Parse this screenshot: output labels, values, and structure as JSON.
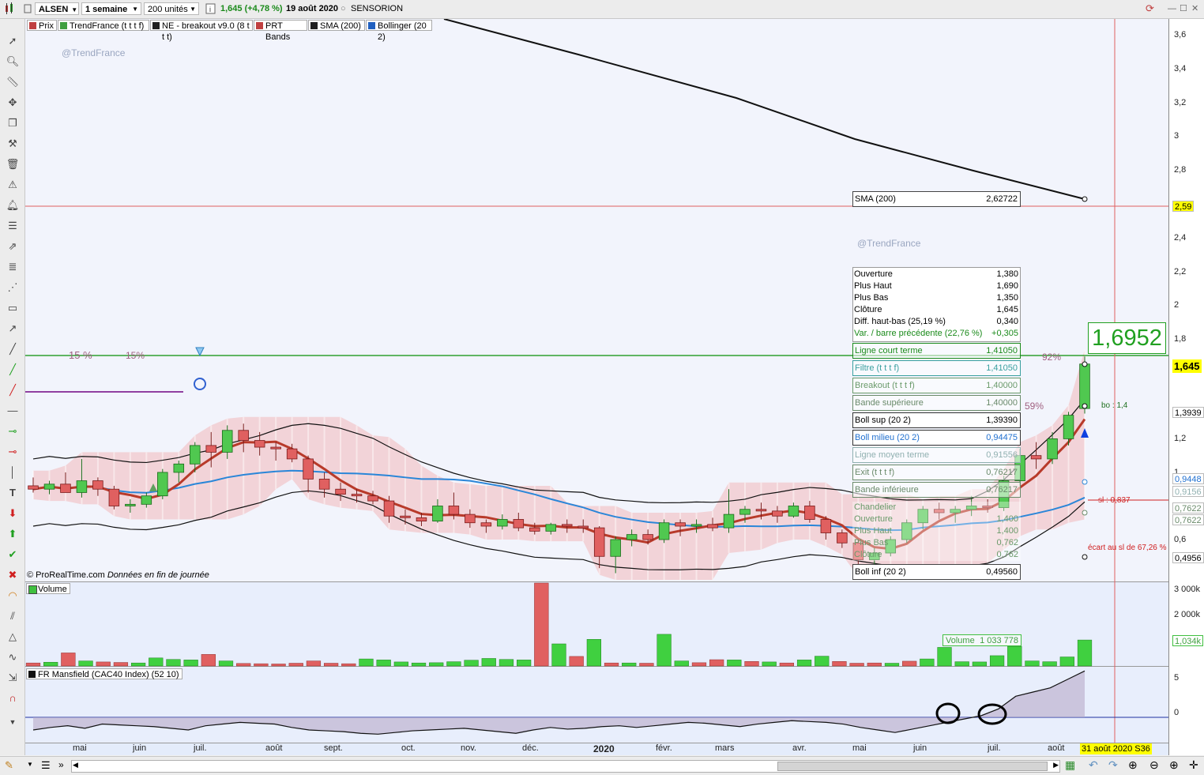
{
  "toolbar": {
    "symbol": "ALSEN",
    "timeframe": "1 semaine",
    "units": "200 unités",
    "quote": "1,645 (+4,78 %)",
    "date": "19 août 2020",
    "name": "SENSORION"
  },
  "indicators": [
    {
      "label": "Prix",
      "color": "#c04040"
    },
    {
      "label": "TrendFrance (t t t f)",
      "color": "#40a040"
    },
    {
      "label": "NE - breakout v9.0 (8 t t t)",
      "color": "#202020"
    },
    {
      "label": "PRT Bands",
      "color": "#c04040"
    },
    {
      "label": "SMA (200)",
      "color": "#202020"
    },
    {
      "label": "Bollinger (20 2)",
      "color": "#2060c0"
    }
  ],
  "watermarks": [
    "@TrendFrance",
    "@TrendFrance"
  ],
  "credit": {
    "source": "© ProRealTime.com",
    "note": "Données en fin de journée"
  },
  "sma_box": {
    "label": "SMA (200)",
    "value": "2,62722"
  },
  "info_rows": [
    {
      "label": "Ouverture",
      "value": "1,380"
    },
    {
      "label": "Plus Haut",
      "value": "1,690"
    },
    {
      "label": "Plus Bas",
      "value": "1,350"
    },
    {
      "label": "Clôture",
      "value": "1,645"
    },
    {
      "label": "Diff. haut-bas (25,19 %)",
      "value": "0,340"
    },
    {
      "label": "Var. / barre précédente (22,76 %)",
      "value": "+0,305"
    }
  ],
  "indicator_rows": [
    {
      "label": "Ligne court terme",
      "value": "1,41050",
      "color": "#1a8a1a"
    },
    {
      "label": "Filtre (t t t f)",
      "value": "1,41050",
      "color": "#3aa0a0"
    },
    {
      "label": "Breakout (t t t f)",
      "value": "1,40000",
      "color": "#6a9a6a"
    },
    {
      "label": "Bande supérieure",
      "value": "1,40000",
      "color": "#6a8a6a"
    },
    {
      "label": "Boll sup (20 2)",
      "value": "1,39390",
      "color": "#000000",
      "boxed": true
    },
    {
      "label": "Boll milieu (20 2)",
      "value": "0,94475",
      "color": "#2070d0",
      "boxed": true
    },
    {
      "label": "Ligne moyen terme",
      "value": "0,91556",
      "color": "#90b0b0"
    },
    {
      "label": "Exit (t t t f)",
      "value": "0,76217",
      "color": "#6a8a6a"
    },
    {
      "label": "Bande inférieure",
      "value": "0,76217",
      "color": "#6a8a6a"
    }
  ],
  "candle_rows": [
    {
      "label": "Chandelier",
      "value": ""
    },
    {
      "label": "Ouverture",
      "value": "1,400"
    },
    {
      "label": "Plus Haut",
      "value": "1,400"
    },
    {
      "label": "Plus Bas",
      "value": "0,762"
    },
    {
      "label": "Clôture",
      "value": "0,762"
    }
  ],
  "boll_inf": {
    "label": "Boll inf (20 2)",
    "value": "0,49560"
  },
  "annotations": {
    "pct_15a": "15 %",
    "pct_15b": "15%",
    "pct_92": "92%",
    "pct_59": "59%",
    "bo": "bo : 1,4",
    "sl": "sl : 0,837",
    "ecart": "écart au sl de 67,26 %",
    "big_price": "1,6952",
    "volume_label": "Volume",
    "volume_value": "1 033 778"
  },
  "right_axis": {
    "price_ticks": [
      "3,6",
      "3,4",
      "3,2",
      "3",
      "2,8",
      "2,6272",
      "2,4",
      "2,2",
      "2",
      "1,8",
      "1,4105",
      "1,2",
      "1",
      "0,6"
    ],
    "price_tags": [
      {
        "text": "2,59",
        "bg": "#ffff00",
        "fg": "#000"
      },
      {
        "text": "1,645",
        "bg": "#ffff00",
        "fg": "#000"
      },
      {
        "text": "1,3939",
        "bg": "#ffffff",
        "fg": "#000"
      },
      {
        "text": "0,9448",
        "bg": "#ffffff",
        "fg": "#2070d0"
      },
      {
        "text": "0,9156",
        "bg": "#ffffff",
        "fg": "#90b0b0"
      },
      {
        "text": "0,7622",
        "bg": "#ffffff",
        "fg": "#6a8a6a"
      },
      {
        "text": "0,7622",
        "bg": "#ffffff",
        "fg": "#6a8a6a"
      },
      {
        "text": "0,4956",
        "bg": "#ffffff",
        "fg": "#000"
      }
    ],
    "volume_ticks": [
      "3 000k",
      "2 000k",
      "1 000k"
    ],
    "volume_tag": "1,034k",
    "mansfield_ticks": [
      "5",
      "0"
    ]
  },
  "volume_panel_title": "Volume",
  "mansfield_panel_title": "FR Mansfield (CAC40 Index) (52 10)",
  "x_axis": [
    "mai",
    "juin",
    "juil.",
    "août",
    "sept.",
    "oct.",
    "nov.",
    "déc.",
    "2020",
    "févr.",
    "mars",
    "avr.",
    "mai",
    "juin",
    "juil.",
    "août"
  ],
  "x_tag": "31 août 2020 S36",
  "chart_data": {
    "type": "candlestick",
    "title": "SENSORION",
    "interval": "1 semaine",
    "ylim": [
      0.4,
      3.7
    ],
    "candles": [
      [
        0.92,
        0.97,
        0.88,
        0.9
      ],
      [
        0.9,
        0.95,
        0.87,
        0.93
      ],
      [
        0.93,
        1.0,
        0.89,
        0.88
      ],
      [
        0.88,
        1.08,
        0.85,
        0.95
      ],
      [
        0.95,
        0.97,
        0.86,
        0.9
      ],
      [
        0.9,
        0.92,
        0.78,
        0.8
      ],
      [
        0.8,
        0.84,
        0.76,
        0.81
      ],
      [
        0.81,
        0.88,
        0.79,
        0.86
      ],
      [
        0.86,
        1.02,
        0.84,
        1.0
      ],
      [
        1.0,
        1.07,
        0.94,
        1.05
      ],
      [
        1.05,
        1.18,
        1.0,
        1.16
      ],
      [
        1.16,
        1.24,
        1.03,
        1.12
      ],
      [
        1.12,
        1.28,
        1.08,
        1.25
      ],
      [
        1.25,
        1.29,
        1.12,
        1.19
      ],
      [
        1.19,
        1.24,
        1.1,
        1.15
      ],
      [
        1.15,
        1.18,
        1.07,
        1.14
      ],
      [
        1.14,
        1.17,
        1.06,
        1.08
      ],
      [
        1.08,
        1.1,
        0.88,
        0.96
      ],
      [
        0.96,
        1.0,
        0.85,
        0.9
      ],
      [
        0.9,
        0.94,
        0.83,
        0.87
      ],
      [
        0.87,
        0.9,
        0.82,
        0.86
      ],
      [
        0.86,
        0.89,
        0.81,
        0.83
      ],
      [
        0.83,
        0.86,
        0.7,
        0.74
      ],
      [
        0.74,
        0.78,
        0.69,
        0.73
      ],
      [
        0.73,
        0.76,
        0.68,
        0.71
      ],
      [
        0.71,
        0.84,
        0.7,
        0.8
      ],
      [
        0.8,
        0.88,
        0.72,
        0.75
      ],
      [
        0.75,
        0.78,
        0.67,
        0.7
      ],
      [
        0.7,
        0.72,
        0.64,
        0.68
      ],
      [
        0.68,
        0.75,
        0.66,
        0.72
      ],
      [
        0.72,
        0.76,
        0.65,
        0.67
      ],
      [
        0.67,
        0.7,
        0.63,
        0.65
      ],
      [
        0.65,
        0.7,
        0.63,
        0.69
      ],
      [
        0.69,
        0.72,
        0.64,
        0.68
      ],
      [
        0.68,
        0.72,
        0.64,
        0.67
      ],
      [
        0.67,
        0.68,
        0.43,
        0.5
      ],
      [
        0.5,
        0.62,
        0.4,
        0.6
      ],
      [
        0.6,
        0.66,
        0.56,
        0.63
      ],
      [
        0.63,
        0.66,
        0.57,
        0.6
      ],
      [
        0.6,
        0.72,
        0.58,
        0.7
      ],
      [
        0.7,
        0.72,
        0.62,
        0.68
      ],
      [
        0.68,
        0.72,
        0.64,
        0.69
      ],
      [
        0.69,
        0.73,
        0.65,
        0.67
      ],
      [
        0.67,
        0.9,
        0.64,
        0.75
      ],
      [
        0.75,
        0.8,
        0.7,
        0.78
      ],
      [
        0.78,
        0.82,
        0.72,
        0.77
      ],
      [
        0.77,
        0.8,
        0.7,
        0.74
      ],
      [
        0.74,
        0.82,
        0.73,
        0.8
      ],
      [
        0.8,
        0.83,
        0.7,
        0.72
      ],
      [
        0.72,
        0.74,
        0.6,
        0.64
      ],
      [
        0.64,
        0.66,
        0.55,
        0.58
      ],
      [
        0.58,
        0.6,
        0.42,
        0.48
      ],
      [
        0.48,
        0.55,
        0.44,
        0.52
      ],
      [
        0.52,
        0.62,
        0.5,
        0.6
      ],
      [
        0.6,
        0.72,
        0.58,
        0.7
      ],
      [
        0.7,
        0.8,
        0.66,
        0.78
      ],
      [
        0.78,
        0.82,
        0.72,
        0.76
      ],
      [
        0.76,
        0.8,
        0.7,
        0.78
      ],
      [
        0.78,
        0.86,
        0.74,
        0.8
      ],
      [
        0.8,
        0.84,
        0.76,
        0.79
      ],
      [
        0.79,
        0.98,
        0.77,
        0.95
      ],
      [
        0.95,
        1.14,
        0.92,
        1.1
      ],
      [
        1.1,
        1.18,
        1.02,
        1.08
      ],
      [
        1.08,
        1.24,
        1.05,
        1.2
      ],
      [
        1.2,
        1.36,
        1.16,
        1.34
      ],
      [
        1.38,
        1.69,
        1.35,
        1.645
      ]
    ],
    "sma200_end": 2.62722,
    "volume": [
      {
        "v": 120,
        "up": false
      },
      {
        "v": 150,
        "up": true
      },
      {
        "v": 520,
        "up": false
      },
      {
        "v": 200,
        "up": true
      },
      {
        "v": 160,
        "up": false
      },
      {
        "v": 140,
        "up": false
      },
      {
        "v": 120,
        "up": true
      },
      {
        "v": 320,
        "up": true
      },
      {
        "v": 260,
        "up": true
      },
      {
        "v": 240,
        "up": true
      },
      {
        "v": 460,
        "up": false
      },
      {
        "v": 200,
        "up": true
      },
      {
        "v": 100,
        "up": false
      },
      {
        "v": 90,
        "up": false
      },
      {
        "v": 80,
        "up": false
      },
      {
        "v": 110,
        "up": false
      },
      {
        "v": 200,
        "up": false
      },
      {
        "v": 110,
        "up": false
      },
      {
        "v": 90,
        "up": false
      },
      {
        "v": 280,
        "up": true
      },
      {
        "v": 240,
        "up": true
      },
      {
        "v": 160,
        "up": true
      },
      {
        "v": 120,
        "up": true
      },
      {
        "v": 130,
        "up": true
      },
      {
        "v": 170,
        "up": true
      },
      {
        "v": 230,
        "up": true
      },
      {
        "v": 300,
        "up": true
      },
      {
        "v": 260,
        "up": true
      },
      {
        "v": 240,
        "up": true
      },
      {
        "v": 3300,
        "up": false
      },
      {
        "v": 880,
        "up": true
      },
      {
        "v": 380,
        "up": false
      },
      {
        "v": 1060,
        "up": true
      },
      {
        "v": 120,
        "up": false
      },
      {
        "v": 120,
        "up": true
      },
      {
        "v": 110,
        "up": false
      },
      {
        "v": 1260,
        "up": true
      },
      {
        "v": 200,
        "up": true
      },
      {
        "v": 130,
        "up": false
      },
      {
        "v": 250,
        "up": false
      },
      {
        "v": 240,
        "up": true
      },
      {
        "v": 180,
        "up": false
      },
      {
        "v": 160,
        "up": true
      },
      {
        "v": 120,
        "up": false
      },
      {
        "v": 240,
        "up": true
      },
      {
        "v": 390,
        "up": true
      },
      {
        "v": 180,
        "up": false
      },
      {
        "v": 110,
        "up": false
      },
      {
        "v": 120,
        "up": false
      },
      {
        "v": 110,
        "up": true
      },
      {
        "v": 190,
        "up": false
      },
      {
        "v": 280,
        "up": true
      },
      {
        "v": 740,
        "up": true
      },
      {
        "v": 170,
        "up": true
      },
      {
        "v": 160,
        "up": true
      },
      {
        "v": 410,
        "up": true
      },
      {
        "v": 780,
        "up": true
      },
      {
        "v": 200,
        "up": true
      },
      {
        "v": 170,
        "up": true
      },
      {
        "v": 360,
        "up": true
      },
      {
        "v": 1034,
        "up": true
      }
    ],
    "volume_ylim": [
      0,
      3300
    ],
    "mansfield": [
      -1.5,
      -1.2,
      -1.0,
      -1.3,
      -0.8,
      -0.9,
      -1.0,
      -1.1,
      -1.3,
      -1.5,
      -1.0,
      -0.8,
      -0.6,
      -0.7,
      -0.8,
      -1.2,
      -1.5,
      -1.6,
      -1.7,
      -1.9,
      -2.0,
      -1.8,
      -1.6,
      -1.5,
      -1.4,
      -1.3,
      -1.5,
      -1.7,
      -1.9,
      -1.5,
      -1.2,
      -1.4,
      -1.3,
      -1.1,
      -1.0,
      -1.2,
      -1.0,
      -0.8,
      -0.6,
      -0.7,
      -0.9,
      -1.1,
      -0.8,
      -0.6,
      -0.4,
      -0.5,
      -0.6,
      -0.8,
      -1.2,
      -1.5,
      -1.8,
      -1.4,
      -1.0,
      -0.6,
      -0.2,
      0.2,
      1.0,
      2.5,
      3.0,
      3.5,
      4.5,
      5.5
    ],
    "mansfield_ylim": [
      -3,
      6
    ]
  }
}
